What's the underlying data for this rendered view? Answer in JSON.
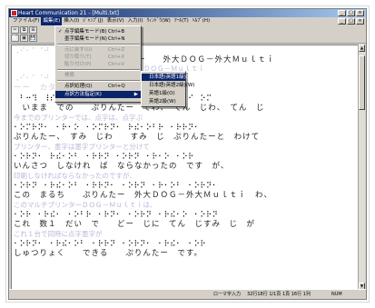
{
  "window": {
    "title": "Heart Communication 21 - [Multi.txt]",
    "buttons": [
      "_",
      "□",
      "×"
    ]
  },
  "menubar": {
    "items": [
      "ファイル(F)",
      "編集(E)",
      "挿入(I)",
      "ｼﾞｬﾝﾌﾟ(J)",
      "表示(V)",
      "入力(I)",
      "ｳｨﾝﾄﾞｳ(W)",
      "ﾂｰﾙ(T)",
      "ﾍﾙﾌﾟ(H)"
    ],
    "active_index": 1
  },
  "toolbar": {
    "tools": [
      "✂",
      "⧉",
      "⊞",
      "📄",
      "▣",
      "💾"
    ]
  },
  "edit_menu": {
    "items": [
      {
        "label": "点字編集モード(B)",
        "shortcut": "Ctrl+B",
        "check": "✓",
        "dim": false
      },
      {
        "label": "墨字編集モード(N)",
        "shortcut": "Ctrl+N",
        "check": "",
        "dim": false
      },
      {
        "label": "元に戻す(U)",
        "shortcut": "Ctrl+Z",
        "check": "",
        "dim": true
      },
      {
        "label": "切り取り(T)",
        "shortcut": "Ctrl+X",
        "check": "",
        "dim": true
      },
      {
        "label": "貼り付け(P)",
        "shortcut": "Ctrl+V",
        "check": "",
        "dim": true
      },
      {
        "label": "検索",
        "shortcut": "",
        "check": "",
        "dim": true
      },
      {
        "label": "点訳処理(Q)",
        "shortcut": "Ctrl+Q",
        "check": "",
        "dim": false
      },
      {
        "label": "点訳方法指定(K)",
        "shortcut": "",
        "check": "",
        "dim": false,
        "active": true,
        "submenu": true
      }
    ]
  },
  "submenu": {
    "items": [
      "日本語(英語1級)(O)",
      "日本語(英語2級)(W)",
      "英語1級(O)",
      "英語2級(W)"
    ],
    "active_index": 0
  },
  "document": {
    "lines": [
      {
        "type": "kana",
        "text": "ぷりんたー　　外大ＤＯＧ－外大Ｍｕｌｔｉ"
      },
      {
        "type": "ink",
        "text": "プリンター　ＤＯＧ－Ｍｕｌｔｉ"
      },
      {
        "type": "braille",
        "text": "⠠⠊⠂⠁⠈⠚⠀⠐⠗⠢⠀⠈⠂⠀⠑⠐⠗⠫"
      },
      {
        "type": "kana",
        "text": "ーー　カタログ"
      },
      {
        "type": "braille",
        "text": "⠀⠃⠒⠹⠀⠸⠎⠀⠂⠅⠮⠊⠀⠐⠝⠂⠂⠀⠳⠍⠀⠑⠐⠗⠀⠫⠗⠀⠅⠊⠀⠕⠍"
      },
      {
        "type": "kana",
        "text": "　いまま　での　　ぷりんたー　でわ、　てん　じわ、　てん　じ"
      },
      {
        "type": "ink",
        "text": "今までのプリンターでは、点字は、点字ぷ"
      },
      {
        "type": "braille",
        "text": "⠂⠕⠍⠗⠝⠂⠀⠂⠗⠂⠕⠀⠂⠕⠍⠗⠝⠂⠀⠗⠮⠂⠕⠃⠗⠀⠂⠗⠗⠝⠂"
      },
      {
        "type": "kana",
        "text": "ぷりんたー、　すみ　じわ　　すみ　じ　ぷりんたーと　わけて"
      },
      {
        "type": "ink",
        "text": "プリンター、墨字は墨字プリンターと分けて"
      },
      {
        "type": "braille",
        "text": "⠂⠕⠗⠝⠂⠀⠗⠮⠂⠕⠃⠀⠂⠗⠗⠝⠀⠂⠕⠗⠝⠀⠂⠗⠂⠕⠀⠂⠕⠗"
      },
      {
        "type": "kana",
        "text": "いんさつ　しなけれ　ば　ならなかったの　です　が、"
      },
      {
        "type": "ink",
        "text": "印刷しなければならなかったのですが、"
      },
      {
        "type": "braille",
        "text": "⠂⠕⠗⠝⠀⠂⠗⠮⠂⠕⠃⠀⠂⠗⠗⠝⠂⠀⠂⠕⠗⠝⠀⠂⠗⠂⠕⠃⠀⠂⠕⠗⠝⠂"
      },
      {
        "type": "kana",
        "text": "この　まるち　　ぷりんたー　外大ＤＯＧ－外大Ｍｕｌｔｉ　わ、"
      },
      {
        "type": "ink",
        "text": "このマルチプリンターＤＯＧ－Ｍｕｌｔｉは、"
      },
      {
        "type": "braille",
        "text": "⠂⠕⠗⠀⠂⠗⠮⠂⠀⠂⠕⠃⠗⠀⠂⠗⠝⠂⠀⠂⠕⠗⠝⠀⠂⠗⠮⠂⠕⠀⠂⠕⠗⠝"
      },
      {
        "type": "kana",
        "text": "これ　数１　だい　で　　どー　じに　てん　じすみ　じ　が"
      },
      {
        "type": "ink",
        "text": "これ１台で同時に点字墨字が"
      },
      {
        "type": "braille",
        "text": "⠂⠕⠗⠝⠂⠀⠂⠗⠮⠂⠕⠃⠀⠂⠗⠗⠝⠀⠂⠕⠗⠝⠂⠀⠂⠗⠮⠂⠀⠂⠕⠗"
      },
      {
        "type": "kana",
        "text": "しゅつりょく　　できる　　ぷりんたー　です。"
      }
    ]
  },
  "statusbar": {
    "mode": "ローマ字入力",
    "cursor": "32行18行 1/1頁 1頁 16行 1列",
    "num": "NUM"
  }
}
